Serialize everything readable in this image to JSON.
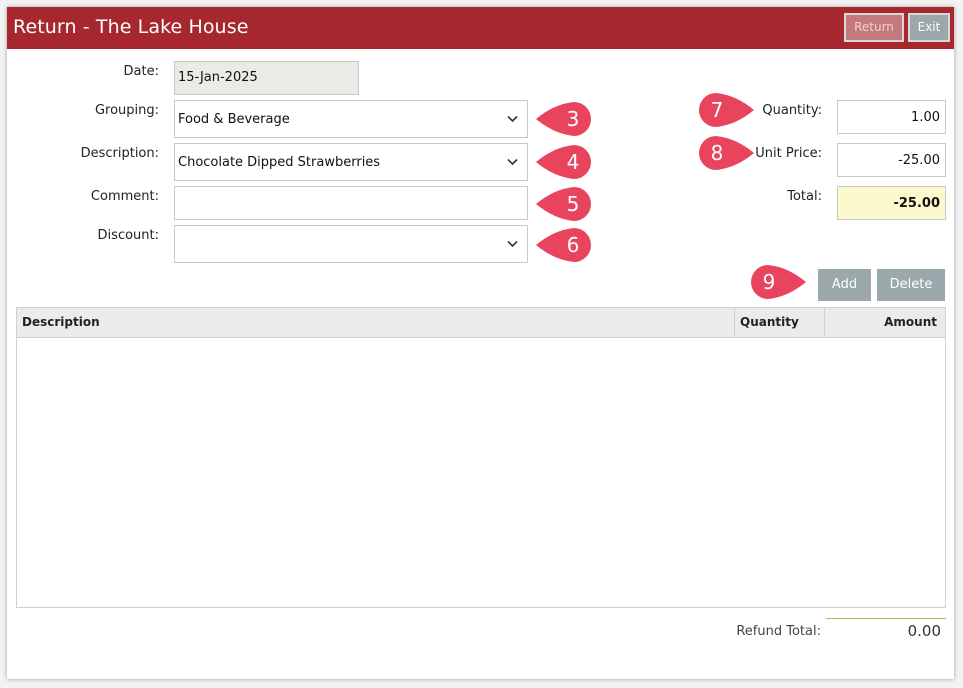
{
  "window": {
    "title": "Return - The Lake House"
  },
  "toolbar": {
    "return_label": "Return",
    "exit_label": "Exit"
  },
  "form": {
    "date": {
      "label": "Date:",
      "value": "15-Jan-2025"
    },
    "grouping": {
      "label": "Grouping:",
      "value": "Food & Beverage"
    },
    "description": {
      "label": "Description:",
      "value": "Chocolate Dipped Strawberries"
    },
    "comment": {
      "label": "Comment:",
      "value": ""
    },
    "discount": {
      "label": "Discount:",
      "value": ""
    },
    "quantity": {
      "label": "Quantity:",
      "value": "1.00"
    },
    "unit_price": {
      "label": "Unit Price:",
      "value": "-25.00"
    },
    "total": {
      "label": "Total:",
      "value": "-25.00"
    }
  },
  "markers": [
    "3",
    "4",
    "5",
    "6",
    "7",
    "8",
    "9"
  ],
  "actions": {
    "add_label": "Add",
    "delete_label": "Delete"
  },
  "table": {
    "columns": [
      "Description",
      "Quantity",
      "Amount"
    ],
    "rows": []
  },
  "footer": {
    "refund_total_label": "Refund Total:",
    "refund_total_value": "0.00"
  },
  "colors": {
    "title_bar": "#a6282e",
    "marker": "#e8445e",
    "button": "#9aa7ab",
    "total_bg": "#fdf9cf"
  }
}
